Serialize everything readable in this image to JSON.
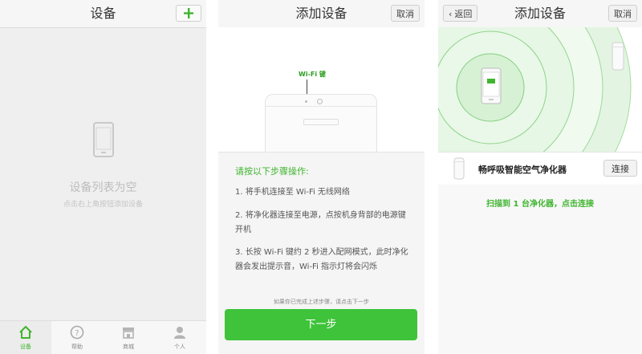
{
  "screen1": {
    "title": "设备",
    "empty_title": "设备列表为空",
    "empty_hint": "点击右上角按钮添加设备",
    "tabs": [
      {
        "label": "设备",
        "icon": "home-icon",
        "active": true
      },
      {
        "label": "帮助",
        "icon": "help-icon",
        "active": false
      },
      {
        "label": "商城",
        "icon": "shop-icon",
        "active": false
      },
      {
        "label": "个人",
        "icon": "person-icon",
        "active": false
      }
    ],
    "accent": "#3fb52f"
  },
  "screen2": {
    "title": "添加设备",
    "cancel_label": "取消",
    "wifi_label": "Wi-Fi 键",
    "steps_title": "请按以下步骤操作:",
    "steps": [
      "1. 将手机连接至 Wi-Fi 无线网络",
      "2. 将净化器连接至电源，点按机身背部的电源键开机",
      "3. 长按 Wi-Fi 键约 2 秒进入配网模式，此时净化器会发出提示音，Wi-Fi 指示灯将会闪烁"
    ],
    "note": "如果你已完成上述步骤，请点击下一步",
    "next_label": "下一步",
    "button_color": "#3ec33a"
  },
  "screen3": {
    "back_label": "返回",
    "title": "添加设备",
    "cancel_label": "取消",
    "device_name": "畅呼吸智能空气净化器",
    "connect_label": "连接",
    "scan_status": "扫描到 1 台净化器，点击连接"
  }
}
